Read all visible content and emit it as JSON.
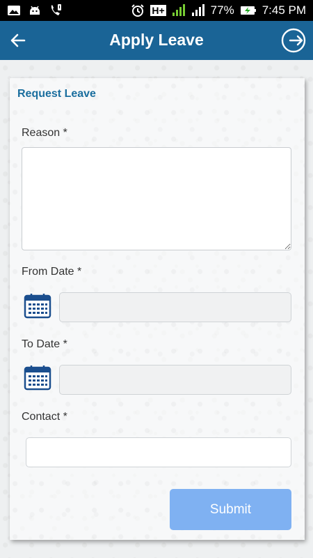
{
  "status_bar": {
    "battery": "77%",
    "time": "7:45 PM",
    "network": "H+",
    "icons": [
      "image-icon",
      "android-icon",
      "call-icon",
      "alarm-icon",
      "signal-icon",
      "battery-charging-icon"
    ]
  },
  "app_bar": {
    "title": "Apply Leave",
    "back_icon": "arrow-left-icon",
    "logout_icon": "logout-icon"
  },
  "form": {
    "title": "Request Leave",
    "reason_label": "Reason *",
    "reason_value": "",
    "from_date_label": "From Date *",
    "from_date_value": "",
    "to_date_label": "To Date *",
    "to_date_value": "",
    "contact_label": "Contact *",
    "contact_value": "",
    "submit_label": "Submit"
  },
  "colors": {
    "app_bar": "#1a6496",
    "accent_title": "#1a6e9e",
    "submit_button": "#7fb1f2",
    "calendar_icon": "#1a4e8e"
  }
}
